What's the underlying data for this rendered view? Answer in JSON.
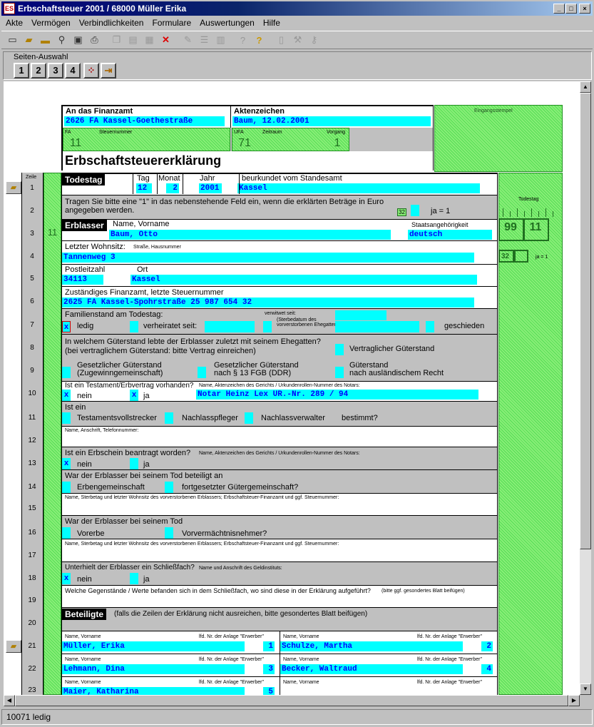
{
  "window": {
    "title": "Erbschaftsteuer 2001 / 68000 Müller Erika",
    "min": "_",
    "max": "□",
    "close": "×"
  },
  "menu": [
    "Akte",
    "Vermögen",
    "Verbindlichkeiten",
    "Formulare",
    "Auswertungen",
    "Hilfe"
  ],
  "seiten": {
    "label": "Seiten-Auswahl",
    "pages": [
      "1",
      "2",
      "3",
      "4"
    ]
  },
  "status": "10071 ledig",
  "form": {
    "finanzamt_label": "An das Finanzamt",
    "finanzamt_value": "2626 FA Kassel-Goethestraße",
    "aktenzeichen_label": "Aktenzeichen",
    "aktenzeichen_value": "Baum, 12.02.2001",
    "eingang": "Eingangsstempel",
    "fa_label": "FA",
    "fa_value": "11",
    "steuernr_label": "Steuernummer",
    "ufa_label": "UFA",
    "ufa_value": "71",
    "zeitraum_label": "Zeitraum",
    "vorgang_label": "Vorgang",
    "vorgang_value": "1",
    "title": "Erbschaftsteuererklärung",
    "zeile_label": "Zeile",
    "todestag": "Todestag",
    "tag_label": "Tag",
    "tag": "12",
    "monat_label": "Monat",
    "monat": "2",
    "jahr_label": "Jahr",
    "jahr": "2001",
    "standesamt_label": "beurkundet vom Standesamt",
    "standesamt": "Kassel",
    "z2_text": "Tragen Sie bitte eine \"1\" in das nebenstehende Feld ein, wenn die erklärten Beträge in Euro angegeben werden.",
    "z2_code": "32",
    "z2_ja": "ja = 1",
    "erblasser": "Erblasser",
    "col11": "11",
    "name_label": "Name, Vorname",
    "name": "Baum, Otto",
    "staat_label": "Staatsangehörigkeit",
    "staat": "deutsch",
    "wohnsitz_label": "Letzter Wohnsitz:",
    "strasse_label": "Straße, Hausnummer",
    "strasse": "Tannenweg 3",
    "plz_label": "Postleitzahl",
    "plz": "34113",
    "ort_label": "Ort",
    "ort": "Kassel",
    "zfa_label": "Zuständiges Finanzamt, letzte Steuernummer",
    "zfa": "2625 FA Kassel-Spohrstraße 25 987 654 32",
    "fam_label": "Familienstand am Todestag:",
    "ledig": "ledig",
    "ledig_x": "x",
    "verh": "verheiratet seit:",
    "verw": "verwitwet seit:",
    "verw_sub": "(Sterbedatum des vorverstorbenen Ehegatten)",
    "gesch": "geschieden",
    "z8a": "In welchem Güterstand lebte der Erblasser zuletzt mit seinem Ehegatten?",
    "z8b": "(bei vertraglichem Güterstand: bitte Vertrag einreichen)",
    "vertr": "Vertraglicher Güterstand",
    "g1a": "Gesetzlicher Güterstand",
    "g1b": "(Zugewinngemeinschaft)",
    "g2a": "Gesetzlicher Güterstand",
    "g2b": "nach § 13 FGB (DDR)",
    "g3a": "Güterstand",
    "g3b": "nach ausländischem Recht",
    "test_q": "Ist ein Testament/Erbvertrag vorhanden?",
    "nein": "nein",
    "ja": "ja",
    "x": "x",
    "notar_label": "Name, Aktenzeichen des Gerichts / Urkundenrollen-Nummer des Notars:",
    "notar": "Notar Heinz Lex UR.-Nr. 289 / 94",
    "isteinl": "Ist ein",
    "tv": "Testamentsvollstrecker",
    "np": "Nachlasspfleger",
    "nv": "Nachlassverwalter",
    "best": "bestimmt?",
    "anschrift_label": "Name, Anschrift, Telefonnummer:",
    "erbschein_q": "Ist ein Erbschein beantragt worden?",
    "erbschein_label": "Name, Aktenzeichen des Gerichts / Urkundenrollen-Nummer des Notars:",
    "z14a": "War der Erblasser bei seinem Tod beteiligt an",
    "eg": "Erbengemeinschaft",
    "fgg": "fortgesetzter Gütergemeinschaft?",
    "vv_label": "Name, Sterbetag und letzter Wohnsitz des vorverstorbenen Erblassers; Erbschaftsteuer-Finanzamt und ggf. Steuernummer:",
    "z16a": "War der Erblasser bei seinem Tod",
    "vorerbe": "Vorerbe",
    "vvn": "Vorvermächtnisnehmer?",
    "sf_q": "Unterhielt der Erblasser ein Schließfach?",
    "sf_label": "Name und Anschrift des Geldinstituts:",
    "z19": "Welche Gegenstände / Werte befanden sich in dem Schließfach, wo sind diese in der Erklärung aufgeführt?",
    "z19b": "(bitte ggf. gesondertes Blatt beifügen)",
    "beteiligte": "Beteiligte",
    "beteiligte_note": "(falls die Zeilen der Erklärung nicht ausreichen, bitte gesondertes Blatt beifügen)",
    "bet_name": "Name, Vorname",
    "bet_nr": "lfd. Nr. der Anlage \"Erwerber\"",
    "rows": [
      "1",
      "2",
      "3",
      "4",
      "5",
      "6",
      "7",
      "8",
      "9",
      "10",
      "11",
      "12",
      "13",
      "14",
      "15",
      "16",
      "17",
      "18",
      "19",
      "20",
      "21",
      "22",
      "23"
    ],
    "right_todestag": "Todestag",
    "r99": "99",
    "r11": "11",
    "r32": "32",
    "rja": "ja = 1",
    "bet": [
      {
        "n": "Müller, Erika",
        "nr": "1"
      },
      {
        "n": "Schulze, Martha",
        "nr": "2"
      },
      {
        "n": "Lehmann, Dina",
        "nr": "3"
      },
      {
        "n": "Becker, Waltraud",
        "nr": "4"
      },
      {
        "n": "Maier, Katharina",
        "nr": "5"
      },
      {
        "n": "",
        "nr": ""
      }
    ]
  }
}
